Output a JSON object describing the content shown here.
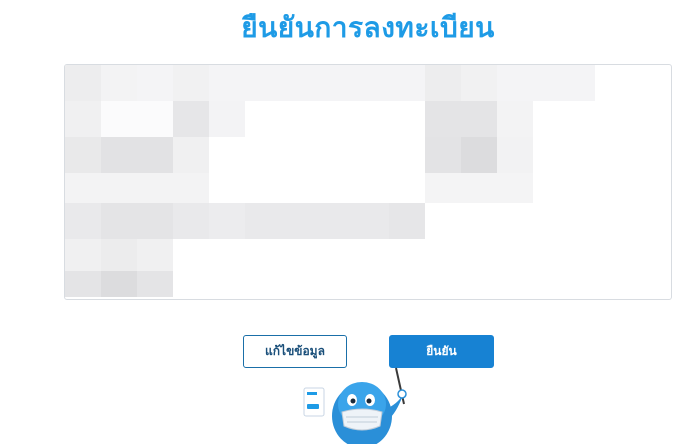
{
  "page": {
    "title": "ยืนยันการลงทะเบียน"
  },
  "info_box": {
    "content_state": "blurred"
  },
  "actions": {
    "edit_label": "แก้ไขข้อมูล",
    "confirm_label": "ยืนยัน"
  },
  "mascot": {
    "icon": "dolphin-mascot-with-mask-icon"
  },
  "colors": {
    "title": "#1e9be6",
    "confirm_button": "#1782d3",
    "edit_border": "#1a6fa8",
    "box_border": "#d8dce1"
  }
}
